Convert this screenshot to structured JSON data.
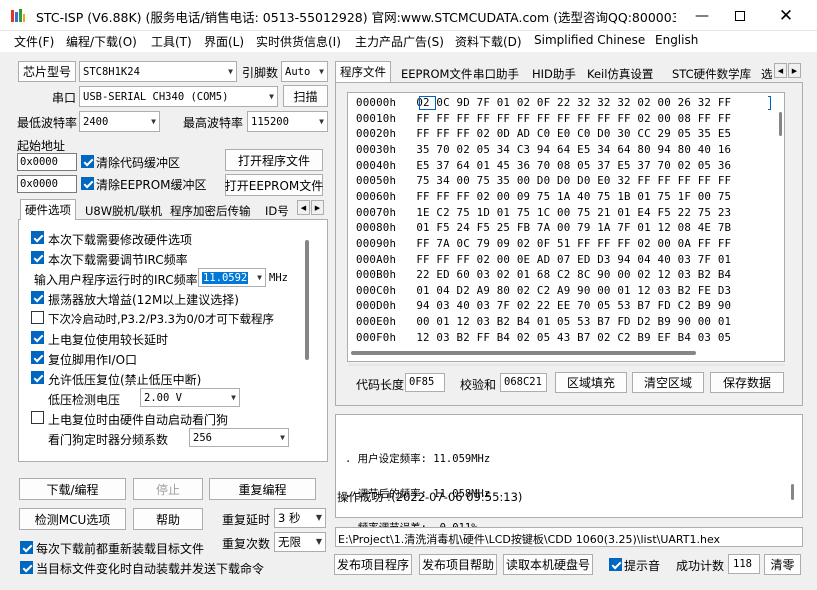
{
  "title": "STC-ISP (V6.88K) (服务电话/销售电话: 0513-55012928) 官网:www.STCMCUDATA.com  (选型咨询QQ:800003751...",
  "menu": [
    "文件(F)",
    "编程/下载(O)",
    "工具(T)",
    "界面(L)",
    "实时供货信息(I)",
    "主力产品广告(S)",
    "资料下载(D)",
    "Simplified Chinese",
    "English"
  ],
  "left": {
    "chip_label": "芯片型号",
    "chip_value": "STC8H1K24",
    "pins_label": "引脚数",
    "pins_value": "Auto",
    "port_label": "串口",
    "port_value": "USB-SERIAL CH340 (COM5)",
    "scan_btn": "扫描",
    "min_baud_label": "最低波特率",
    "min_baud": "2400",
    "max_baud_label": "最高波特率",
    "max_baud": "115200",
    "start_addr_label": "起始地址",
    "addr1": "0x0000",
    "clear_code": "清除代码缓冲区",
    "open_prog": "打开程序文件",
    "addr2": "0x0000",
    "clear_eeprom": "清除EEPROM缓冲区",
    "open_eeprom": "打开EEPROM文件",
    "tabs": [
      "硬件选项",
      "U8W脱机/联机",
      "程序加密后传输",
      "ID号"
    ],
    "options": [
      {
        "label": "本次下载需要修改硬件选项",
        "checked": true
      },
      {
        "label": "本次下载需要调节IRC频率",
        "checked": true
      }
    ],
    "irc_label": "输入用户程序运行时的IRC频率",
    "irc_value": "11.0592",
    "irc_unit": "MHz",
    "options2": [
      {
        "label": "振荡器放大增益(12M以上建议选择)",
        "checked": true
      },
      {
        "label": "下次冷启动时,P3.2/P3.3为0/0才可下载程序",
        "checked": false
      },
      {
        "label": "上电复位使用较长延时",
        "checked": true
      },
      {
        "label": "复位脚用作I/O口",
        "checked": true
      },
      {
        "label": "允许低压复位(禁止低压中断)",
        "checked": true
      }
    ],
    "lvd_label": "低压检测电压",
    "lvd_value": "2.00 V",
    "wdt_label": "上电复位时由硬件自动启动看门狗",
    "wdt_div_label": "看门狗定时器分频系数",
    "wdt_div_value": "256",
    "btn_download": "下载/编程",
    "btn_stop": "停止",
    "btn_reprog": "重复编程",
    "btn_detect": "检测MCU选项",
    "btn_help": "帮助",
    "repeat_delay_label": "重复延时",
    "repeat_delay": "3 秒",
    "repeat_count_label": "重复次数",
    "repeat_count": "无限",
    "reload_each": "每次下载前都重新装载目标文件",
    "auto_reload": "当目标文件变化时自动装载并发送下载命令"
  },
  "right": {
    "tabs": [
      "程序文件",
      "EEPROM文件",
      "串口助手",
      "HID助手",
      "Keil仿真设置",
      "STC硬件数学库",
      "选"
    ],
    "hex_rows": [
      [
        "00000h",
        "02 0C 9D 7F 01 02 0F 22 32 32 32 02 00 26 32 FF"
      ],
      [
        "00010h",
        "FF FF FF FF FF FF FF FF FF FF FF 02 00 08 FF FF"
      ],
      [
        "00020h",
        "FF FF FF 02 0D AD C0 E0 C0 D0 30 CC 29 05 35 E5"
      ],
      [
        "00030h",
        "35 70 02 05 34 C3 94 64 E5 34 64 80 94 80 40 16"
      ],
      [
        "00040h",
        "E5 37 64 01 45 36 70 08 05 37 E5 37 70 02 05 36"
      ],
      [
        "00050h",
        "75 34 00 75 35 00 D0 D0 D0 E0 32 FF FF FF FF FF"
      ],
      [
        "00060h",
        "FF FF FF 02 00 09 75 1A 40 75 1B 01 75 1F 00 75"
      ],
      [
        "00070h",
        "1E C2 75 1D 01 75 1C 00 75 21 01 E4 F5 22 75 23"
      ],
      [
        "00080h",
        "01 F5 24 F5 25 FB 7A 00 79 1A 7F 01 12 08 4E 7B"
      ],
      [
        "00090h",
        "FF 7A 0C 79 09 02 0F 51 FF FF FF 02 00 0A FF FF"
      ],
      [
        "000A0h",
        "FF FF FF 02 00 0E AD 07 ED D3 94 04 40 03 7F 01"
      ],
      [
        "000B0h",
        "22 ED 60 03 02 01 68 C2 8C 90 00 02 12 03 B2 B4"
      ],
      [
        "000C0h",
        "01 04 D2 A9 80 02 C2 A9 90 00 01 12 03 B2 FE D3"
      ],
      [
        "000D0h",
        "94 03 40 03 7F 02 22 EE 70 05 53 B7 FD C2 B9 90"
      ],
      [
        "000E0h",
        "00 01 12 03 B2 B4 01 05 53 B7 FD D2 B9 90 00 01"
      ],
      [
        "000F0h",
        "12 03 B2 FF B4 02 05 43 B7 02 C2 B9 EF B4 03 05"
      ]
    ],
    "code_len_label": "代码长度",
    "code_len": "0F85",
    "checksum_label": "校验和",
    "checksum": "068C21",
    "btn_fill": "区域填充",
    "btn_clear": "清空区域",
    "btn_save": "保存数据",
    "log_lines": [
      ". 用户设定频率: 11.059MHz",
      ". 调节后的频率: 11.058MHz",
      ". 频率调节误差: -0.011%"
    ],
    "log_result": "操作成功 !(2022-07-06 09:55:13)",
    "path": "E:\\Project\\1.清洗消毒机\\硬件\\LCD按键板\\CDD 1060(3.25)\\list\\UART1.hex",
    "btn_publish": "发布项目程序",
    "btn_publish_help": "发布项目帮助",
    "btn_hdd": "读取本机硬盘号",
    "sound_label": "提示音",
    "success_label": "成功计数",
    "success_count": "118",
    "btn_reset": "清零"
  }
}
